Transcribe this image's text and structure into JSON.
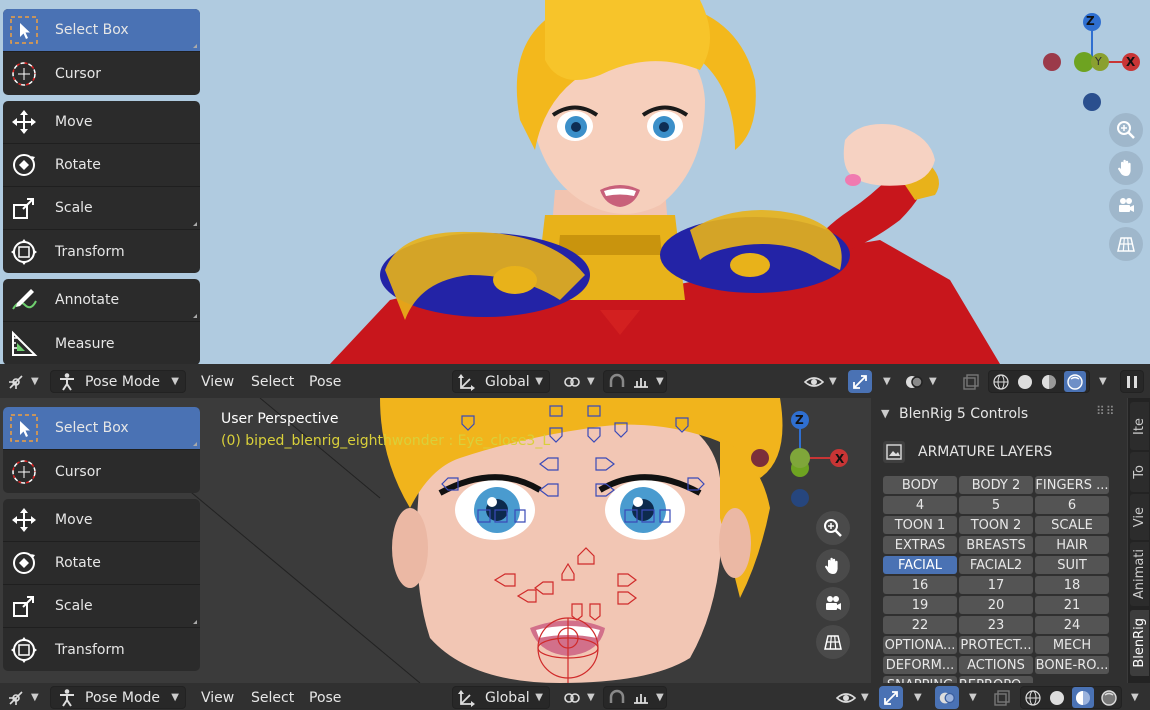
{
  "tools_top": [
    {
      "label": "Select Box",
      "icon": "select-box-icon",
      "active": true
    },
    {
      "label": "Cursor",
      "icon": "cursor-icon"
    },
    {
      "label": "Move",
      "icon": "move-icon"
    },
    {
      "label": "Rotate",
      "icon": "rotate-icon"
    },
    {
      "label": "Scale",
      "icon": "scale-icon"
    },
    {
      "label": "Transform",
      "icon": "transform-icon"
    },
    {
      "label": "Annotate",
      "icon": "annotate-icon"
    },
    {
      "label": "Measure",
      "icon": "measure-icon"
    }
  ],
  "tools_bottom": [
    {
      "label": "Select Box",
      "icon": "select-box-icon",
      "active": true
    },
    {
      "label": "Cursor",
      "icon": "cursor-icon"
    },
    {
      "label": "Move",
      "icon": "move-icon"
    },
    {
      "label": "Rotate",
      "icon": "rotate-icon"
    },
    {
      "label": "Scale",
      "icon": "scale-icon"
    },
    {
      "label": "Transform",
      "icon": "transform-icon"
    }
  ],
  "header": {
    "mode": "Pose Mode",
    "menus": [
      "View",
      "Select",
      "Pose"
    ],
    "orientation": "Global"
  },
  "viewport_bottom": {
    "title": "User Perspective",
    "subtitle": "(0) biped_blenrig_eighthwonder : Eye_close3_L"
  },
  "gizmo": {
    "x": "X",
    "y": "Y",
    "z": "Z"
  },
  "sidebar": {
    "panel_title": "BlenRig 5 Controls",
    "section": "ARMATURE LAYERS",
    "layers": [
      "BODY",
      "BODY 2",
      "FINGERS ...",
      "4",
      "5",
      "6",
      "TOON 1",
      "TOON 2",
      "SCALE",
      "EXTRAS",
      "BREASTS",
      "HAIR",
      "FACIAL",
      "FACIAL2",
      "SUIT",
      "16",
      "17",
      "18",
      "19",
      "20",
      "21",
      "22",
      "23",
      "24",
      "OPTIONA...",
      "PROTECT...",
      "MECH",
      "DEFORM...",
      "ACTIONS",
      "BONE-RO...",
      "SNAPPING",
      "REPROPO..."
    ],
    "active_layer": "FACIAL"
  },
  "tabs": [
    "Ite",
    "To",
    "Vie",
    "Animati",
    "BlenRig"
  ],
  "active_tab": "BlenRig",
  "colors": {
    "accent": "#4a72b4",
    "axis_x": "#c83535",
    "axis_y": "#6ea321",
    "axis_z": "#2f6fd0"
  }
}
